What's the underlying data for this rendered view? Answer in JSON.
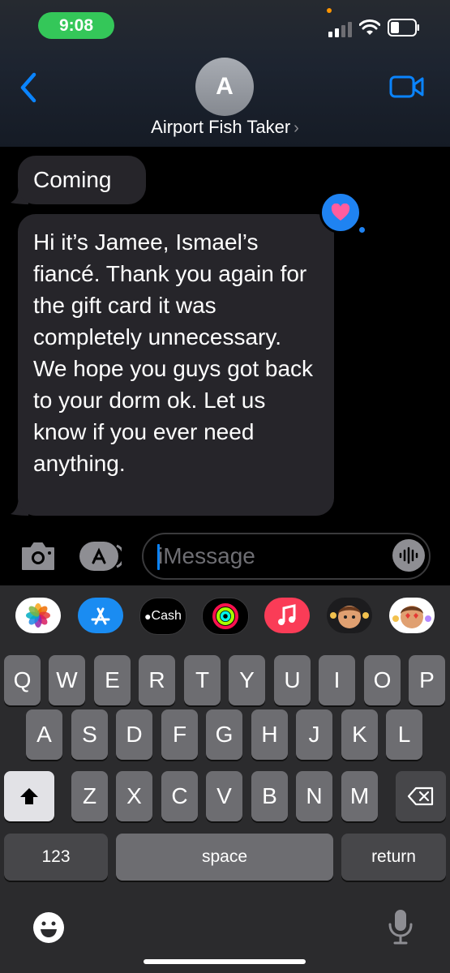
{
  "status_bar": {
    "time": "9:08"
  },
  "header": {
    "avatar_initial": "A",
    "contact_name": "Airport Fish Taker",
    "chevron": "›"
  },
  "messages": [
    {
      "text": "Coming"
    },
    {
      "text": "Hi it’s Jamee, Ismael’s fiancé. Thank you again for the gift card it was completely unnecessary. We hope you guys got back to your dorm ok. Let us know if you ever need anything."
    }
  ],
  "tapback": {
    "icon": "heart-icon",
    "color": "#1f83f2"
  },
  "compose": {
    "placeholder": "iMessage"
  },
  "app_strip": {
    "cash_label": "Cash",
    "icons": [
      "photos-icon",
      "app-store-icon",
      "apple-cash-icon",
      "activity-icon",
      "music-icon",
      "memoji-icon",
      "animoji-icon"
    ]
  },
  "keyboard": {
    "row1": [
      "Q",
      "W",
      "E",
      "R",
      "T",
      "Y",
      "U",
      "I",
      "O",
      "P"
    ],
    "row2": [
      "A",
      "S",
      "D",
      "F",
      "G",
      "H",
      "J",
      "K",
      "L"
    ],
    "row3": [
      "Z",
      "X",
      "C",
      "V",
      "B",
      "N",
      "M"
    ],
    "numbers_label": "123",
    "space_label": "space",
    "return_label": "return"
  },
  "colors": {
    "accent": "#0a84ff",
    "time_pill": "#34c759",
    "bubble": "#26252a"
  }
}
